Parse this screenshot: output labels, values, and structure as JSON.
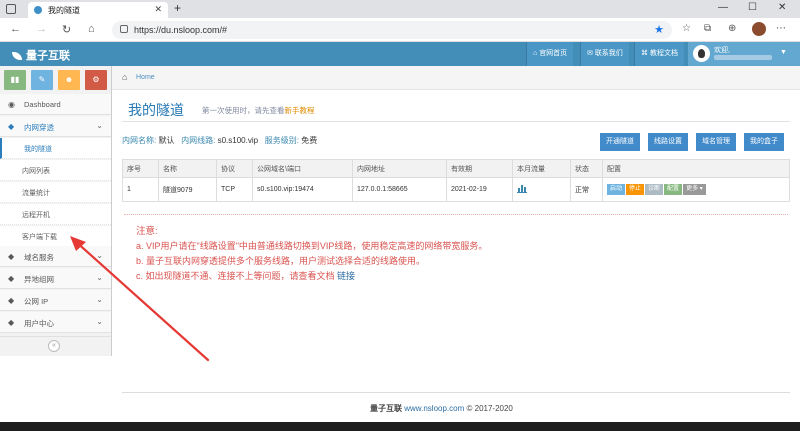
{
  "browser": {
    "tab_title": "我的隧道",
    "url": "https://du.nsloop.com/#"
  },
  "header": {
    "brand": "量子互联",
    "buttons": [
      "官网首页",
      "联系我们",
      "教程文档"
    ],
    "welcome": "欢迎,"
  },
  "breadcrumb": {
    "home": "Home"
  },
  "sidebar": {
    "items": [
      {
        "label": "Dashboard",
        "icon": "dashboard-icon"
      },
      {
        "label": "内网穿透",
        "icon": "tag-icon"
      },
      {
        "label": "域名服务",
        "icon": "tag-icon"
      },
      {
        "label": "异地组网",
        "icon": "tag-icon"
      },
      {
        "label": "公网 IP",
        "icon": "tag-icon"
      },
      {
        "label": "用户中心",
        "icon": "tag-icon"
      }
    ],
    "subitems": [
      "我的隧道",
      "内网列表",
      "流量统计",
      "远程开机",
      "客户端下载"
    ]
  },
  "page": {
    "title": "我的隧道",
    "subtitle": "第一次使用时，请先查看",
    "tutorial_link": "新手教程",
    "intranet_label": "内网名称:",
    "intranet_value": "默认",
    "line_label": "内网线路:",
    "line_value": "s0.s100.vip",
    "level_label": "服务级别:",
    "level_value": "免费"
  },
  "actions": [
    "开通隧道",
    "线路设置",
    "域名管理",
    "我的盒子"
  ],
  "table": {
    "headers": [
      "序号",
      "名称",
      "协议",
      "公网域名\\端口",
      "内网地址",
      "有效期",
      "本月流量",
      "状态",
      "配置"
    ],
    "rows": [
      {
        "no": "1",
        "name": "隧道9079",
        "proto": "TCP",
        "public": "s0.s100.vip:19474",
        "local": "127.0.0.1:58665",
        "expire": "2021-02-19",
        "status": "正常"
      }
    ],
    "op_buttons": [
      {
        "label": "启动",
        "color": "#6fb3e0"
      },
      {
        "label": "停止",
        "color": "#f89406"
      },
      {
        "label": "诊断",
        "color": "#abbac3"
      },
      {
        "label": "配置",
        "color": "#87b87f"
      },
      {
        "label": "更多 ▾",
        "color": "#999999"
      }
    ]
  },
  "notice": {
    "title": "注意:",
    "line_a": "a. VIP用户请在\"线路设置\"中由普通线路切换到VIP线路，使用稳定高速的网络带宽服务。",
    "line_b": "b. 量子互联内网穿透提供多个服务线路，用户测试选择合适的线路使用。",
    "line_c": "c. 如出现隧道不通、连接不上等问题，请查看文档",
    "line_c_link": "链接"
  },
  "footer": {
    "brand": "量子互联",
    "site": "www.nsloop.com",
    "copyright": "© 2017-2020"
  },
  "colors": {
    "header_bg": "#438eb9",
    "primary_btn": "#428bca",
    "title_blue": "#2679b5",
    "notice_red": "#d9534f",
    "arrow_red": "#e53935"
  }
}
